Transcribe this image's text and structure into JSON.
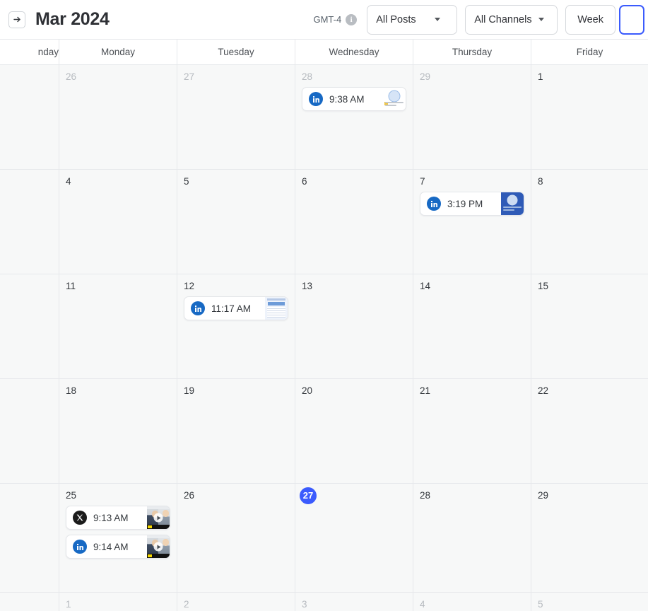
{
  "topbar": {
    "sidebar_toggle_icon": "arrow-right-icon",
    "title": "Mar 2024",
    "timezone_label": "GMT-4",
    "info_icon": "info-icon",
    "posts_filter": {
      "label": "All Posts",
      "caret_icon": "chevron-down-icon"
    },
    "channels_filter": {
      "label": "All Channels",
      "caret_icon": "chevron-down-icon"
    },
    "view_modes": [
      {
        "label": "Week",
        "active": false
      },
      {
        "label": "",
        "active": true
      }
    ]
  },
  "calendar": {
    "day_headers": [
      "nday",
      "Monday",
      "Tuesday",
      "Wednesday",
      "Thursday",
      "Friday"
    ],
    "weeks": [
      {
        "days": [
          {
            "num": "",
            "muted": true,
            "today": false,
            "events": []
          },
          {
            "num": "26",
            "muted": true,
            "today": false,
            "events": []
          },
          {
            "num": "27",
            "muted": true,
            "today": false,
            "events": []
          },
          {
            "num": "28",
            "muted": true,
            "today": false,
            "events": [
              {
                "channel": "linkedin",
                "channel_icon": "linkedin-icon",
                "time": "9:38 AM",
                "thumb": "doc-white"
              }
            ]
          },
          {
            "num": "29",
            "muted": true,
            "today": false,
            "events": []
          },
          {
            "num": "1",
            "muted": false,
            "today": false,
            "events": []
          }
        ]
      },
      {
        "days": [
          {
            "num": "",
            "muted": false,
            "today": false,
            "events": []
          },
          {
            "num": "4",
            "muted": false,
            "today": false,
            "events": []
          },
          {
            "num": "5",
            "muted": false,
            "today": false,
            "events": []
          },
          {
            "num": "6",
            "muted": false,
            "today": false,
            "events": []
          },
          {
            "num": "7",
            "muted": false,
            "today": false,
            "events": [
              {
                "channel": "linkedin",
                "channel_icon": "linkedin-icon",
                "time": "3:19 PM",
                "thumb": "blue-solid"
              }
            ]
          },
          {
            "num": "8",
            "muted": false,
            "today": false,
            "events": []
          }
        ]
      },
      {
        "days": [
          {
            "num": "",
            "muted": false,
            "today": false,
            "events": []
          },
          {
            "num": "11",
            "muted": false,
            "today": false,
            "events": []
          },
          {
            "num": "12",
            "muted": false,
            "today": false,
            "events": [
              {
                "channel": "linkedin",
                "channel_icon": "linkedin-icon",
                "time": "11:17 AM",
                "thumb": "doc-sheet"
              }
            ]
          },
          {
            "num": "13",
            "muted": false,
            "today": false,
            "events": []
          },
          {
            "num": "14",
            "muted": false,
            "today": false,
            "events": []
          },
          {
            "num": "15",
            "muted": false,
            "today": false,
            "events": []
          }
        ]
      },
      {
        "days": [
          {
            "num": "",
            "muted": false,
            "today": false,
            "events": []
          },
          {
            "num": "18",
            "muted": false,
            "today": false,
            "events": []
          },
          {
            "num": "19",
            "muted": false,
            "today": false,
            "events": []
          },
          {
            "num": "20",
            "muted": false,
            "today": false,
            "events": []
          },
          {
            "num": "21",
            "muted": false,
            "today": false,
            "events": []
          },
          {
            "num": "22",
            "muted": false,
            "today": false,
            "events": []
          }
        ]
      },
      {
        "days": [
          {
            "num": "",
            "muted": false,
            "today": false,
            "events": []
          },
          {
            "num": "25",
            "muted": false,
            "today": false,
            "events": [
              {
                "channel": "x",
                "channel_icon": "x-icon",
                "time": "9:13 AM",
                "thumb": "video"
              },
              {
                "channel": "linkedin",
                "channel_icon": "linkedin-icon",
                "time": "9:14 AM",
                "thumb": "video"
              }
            ]
          },
          {
            "num": "26",
            "muted": false,
            "today": false,
            "events": []
          },
          {
            "num": "27",
            "muted": false,
            "today": true,
            "events": []
          },
          {
            "num": "28",
            "muted": false,
            "today": false,
            "events": []
          },
          {
            "num": "29",
            "muted": false,
            "today": false,
            "events": []
          }
        ]
      },
      {
        "days": [
          {
            "num": "",
            "muted": true,
            "today": false,
            "events": []
          },
          {
            "num": "1",
            "muted": true,
            "today": false,
            "events": []
          },
          {
            "num": "2",
            "muted": true,
            "today": false,
            "events": []
          },
          {
            "num": "3",
            "muted": true,
            "today": false,
            "events": []
          },
          {
            "num": "4",
            "muted": true,
            "today": false,
            "events": []
          },
          {
            "num": "5",
            "muted": true,
            "today": false,
            "events": []
          }
        ]
      }
    ]
  },
  "colors": {
    "accent": "#3b5bfd",
    "linkedin": "#1769c4",
    "x": "#1b1b1b",
    "grid_line": "#e6e8eb",
    "cell_bg": "#f7f8f8"
  }
}
